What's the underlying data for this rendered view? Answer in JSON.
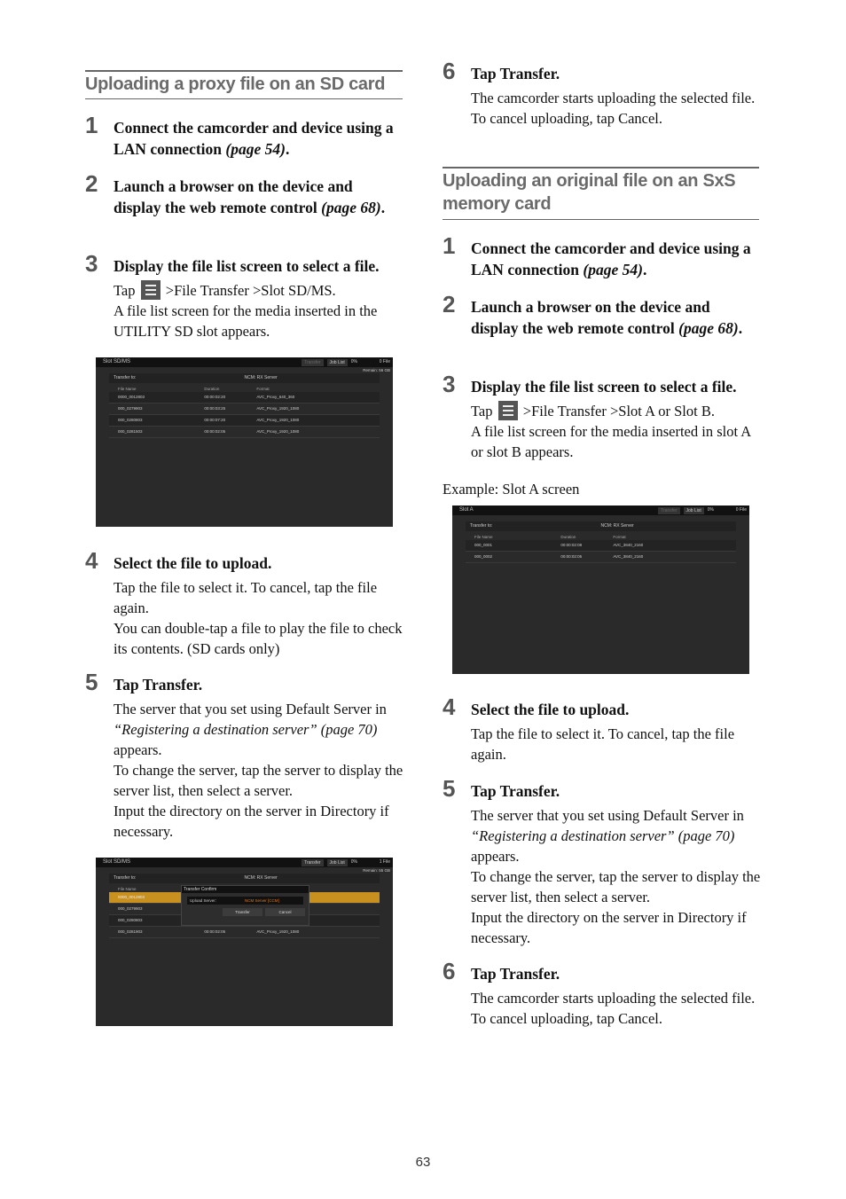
{
  "page_number": "63",
  "left": {
    "heading": "Uploading a proxy file on an SD card",
    "steps": [
      {
        "num": "1",
        "title": "Connect the camcorder and device using a LAN connection",
        "ref": "(page 54)",
        "end": "."
      },
      {
        "num": "2",
        "title": "Launch a browser on the device and display the web remote control",
        "ref": "(page 68)",
        "end": "."
      },
      {
        "num": "3",
        "title": "Display the file list screen to select a file.",
        "body_pre": "Tap",
        "body_post": ">File Transfer >Slot SD/MS.",
        "body2": "A file list screen for the media inserted in the UTILITY SD slot appears."
      },
      {
        "num": "4",
        "title": "Select the file to upload.",
        "body": "Tap the file to select it. To cancel, tap the file again.",
        "body2": "You can double-tap a file to play the file to check its contents. (SD cards only)"
      },
      {
        "num": "5",
        "title": "Tap Transfer.",
        "body_a": "The server that you set using Default Server in",
        "body_ref": "“Registering a destination server” (page 70)",
        "body_b": "appears.",
        "body2": "To change the server, tap the server to display the server list, then select a server.",
        "body3": "Input the directory on the server in Directory if necessary."
      }
    ],
    "screen1": {
      "title": "Slot SD/MS",
      "transfer_btn": "Transfer",
      "joblist_btn": "Job List",
      "progress": "0%",
      "files": "0 File",
      "remain": "Remain: 56 GB",
      "transfer_to": "Transfer to:",
      "server": "NCM: RX Server",
      "columns": [
        "File Name",
        "Duration",
        "Format"
      ],
      "rows": [
        [
          "0000_0012803",
          "00:00:02:20",
          "AVC_Proxy_640_360"
        ],
        [
          "000_0279903",
          "00:00:03:25",
          "AVC_Proxy_1920_1080"
        ],
        [
          "000_0280803",
          "00:00:07:20",
          "AVC_Proxy_1920_1080"
        ],
        [
          "000_0281503",
          "00:00:02:05",
          "AVC_Proxy_1920_1080"
        ]
      ]
    },
    "screen2": {
      "title": "Slot SD/MS",
      "transfer_btn": "Transfer",
      "joblist_btn": "Job List",
      "progress": "0%",
      "files": "1 File",
      "remain": "Remain: 55 GB",
      "transfer_to": "Transfer to:",
      "server": "NCM: RX Server",
      "columns": [
        "File Name"
      ],
      "rows": [
        [
          "0000_0012803",
          "",
          ""
        ],
        [
          "000_0279903",
          "",
          ""
        ],
        [
          "000_0280803",
          "",
          ""
        ],
        [
          "000_0281903",
          "00:00:02:05",
          "AVC_Proxy_1920_1080"
        ]
      ],
      "dialog": {
        "title": "Transfer Confirm",
        "label": "Upload Server:",
        "value": "NCM Server [CCM]",
        "transfer": "Transfer",
        "cancel": "Cancel"
      }
    }
  },
  "right": {
    "step6_top": {
      "num": "6",
      "title": "Tap Transfer.",
      "body": "The camcorder starts uploading the selected file.",
      "body2": "To cancel uploading, tap Cancel."
    },
    "heading": "Uploading an original file on an SxS memory card",
    "steps": [
      {
        "num": "1",
        "title": "Connect the camcorder and device using a LAN connection",
        "ref": "(page 54)",
        "end": "."
      },
      {
        "num": "2",
        "title": "Launch a browser on the device and display the web remote control",
        "ref": "(page 68)",
        "end": "."
      },
      {
        "num": "3",
        "title": "Display the file list screen to select a file.",
        "body_pre": "Tap",
        "body_post": ">File Transfer >Slot A or Slot B.",
        "body2": "A file list screen for the media inserted in slot A or slot B appears."
      },
      {
        "num": "4",
        "title": "Select the file to upload.",
        "body": "Tap the file to select it. To cancel, tap the file again."
      },
      {
        "num": "5",
        "title": "Tap Transfer.",
        "body_a": "The server that you set using Default Server in",
        "body_ref": "“Registering a destination server” (page 70)",
        "body_b": "appears.",
        "body2": "To change the server, tap the server to display the server list, then select a server.",
        "body3": "Input the directory on the server in Directory if necessary."
      },
      {
        "num": "6",
        "title": "Tap Transfer.",
        "body": "The camcorder starts uploading the selected file.",
        "body2": "To cancel uploading, tap Cancel."
      }
    ],
    "example_label": "Example: Slot A screen",
    "screen": {
      "title": "Slot A",
      "transfer_btn": "Transfer",
      "joblist_btn": "Job List",
      "progress": "0%",
      "files": "0 File",
      "transfer_to": "Transfer to:",
      "server": "NCM: RX Server",
      "columns": [
        "File Name",
        "Duration",
        "Format"
      ],
      "rows": [
        [
          "000_0001",
          "00:00:02:08",
          "AVC_3840_2160"
        ],
        [
          "000_0002",
          "00:00:02:05",
          "AVC_3840_2160"
        ]
      ]
    }
  }
}
